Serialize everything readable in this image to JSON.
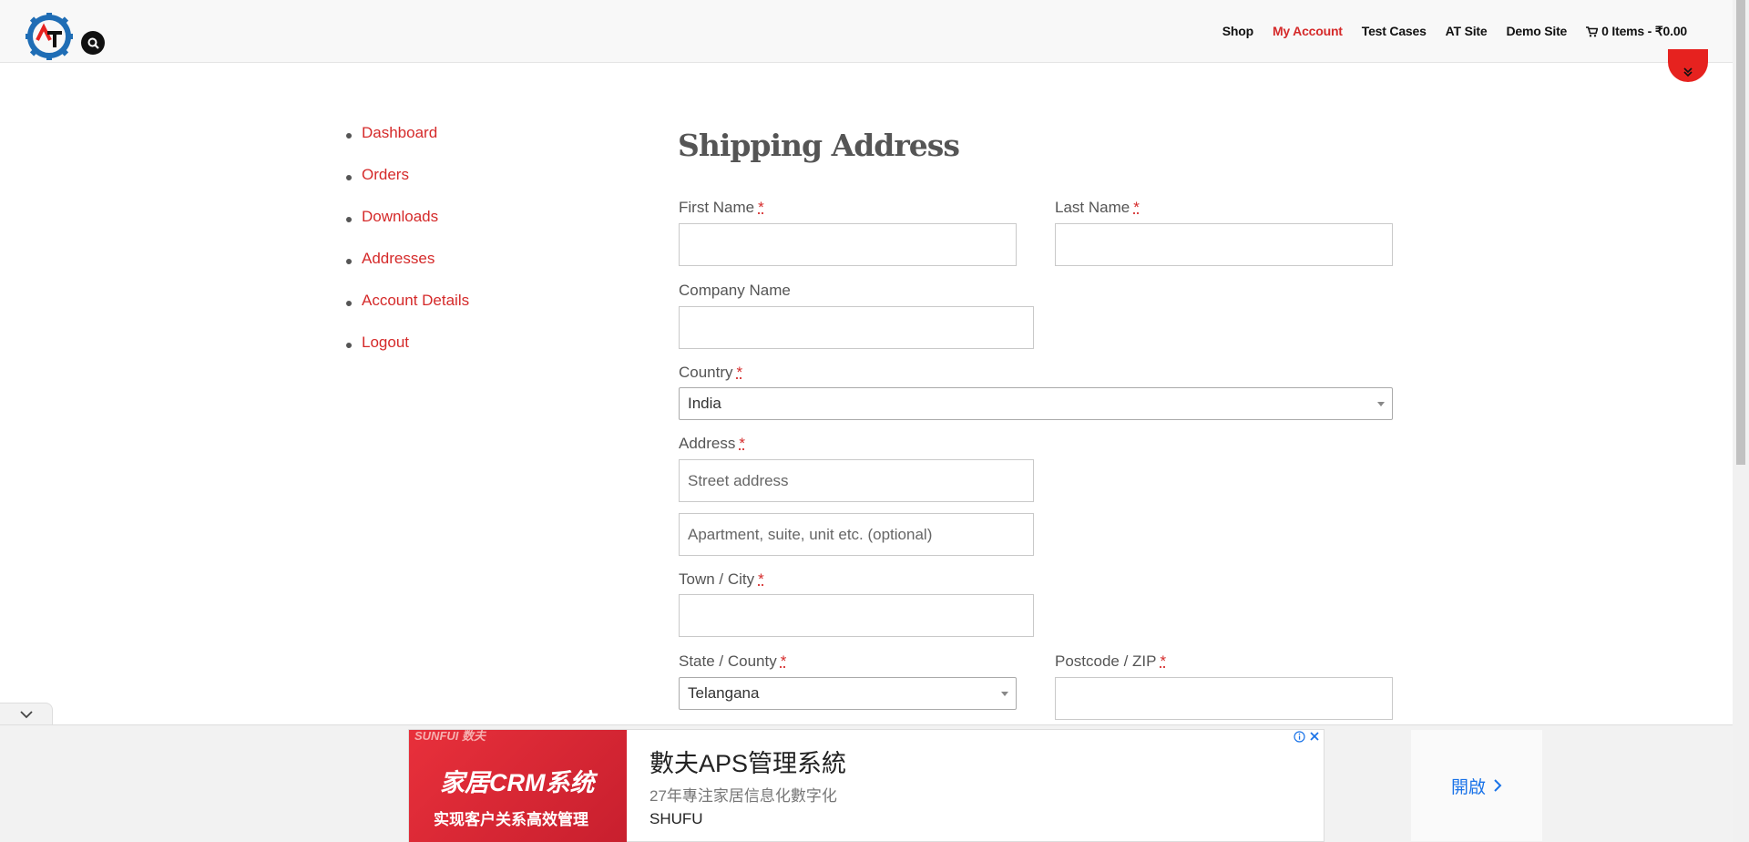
{
  "header": {
    "nav": [
      {
        "label": "Shop"
      },
      {
        "label": "My Account"
      },
      {
        "label": "Test Cases"
      },
      {
        "label": "AT Site"
      },
      {
        "label": "Demo Site"
      }
    ],
    "cart_label": "0 Items - ₹0.00"
  },
  "sidebar": {
    "items": [
      {
        "label": "Dashboard"
      },
      {
        "label": "Orders"
      },
      {
        "label": "Downloads"
      },
      {
        "label": "Addresses"
      },
      {
        "label": "Account Details"
      },
      {
        "label": "Logout"
      }
    ]
  },
  "form": {
    "title": "Shipping Address",
    "required_mark": "*",
    "first_name_label": "First Name",
    "last_name_label": "Last Name",
    "company_label": "Company Name",
    "country_label": "Country",
    "country_value": "India",
    "address_label": "Address",
    "address1_placeholder": "Street address",
    "address2_placeholder": "Apartment, suite, unit etc. (optional)",
    "city_label": "Town / City",
    "state_label": "State / County",
    "state_value": "Telangana",
    "postcode_label": "Postcode / ZIP"
  },
  "ad": {
    "brand": "SUNFUI 数夫",
    "image_line1": "家居CRM系统",
    "image_line2": "实现客户关系高效管理",
    "headline": "數夫APS管理系統",
    "subline": "27年專注家居信息化數字化",
    "advertiser": "SHUFU",
    "cta": "開啟"
  },
  "colors": {
    "accent": "#d52a2a",
    "logo_blue": "#1f6db5",
    "scroll_top": "#e6221f"
  }
}
